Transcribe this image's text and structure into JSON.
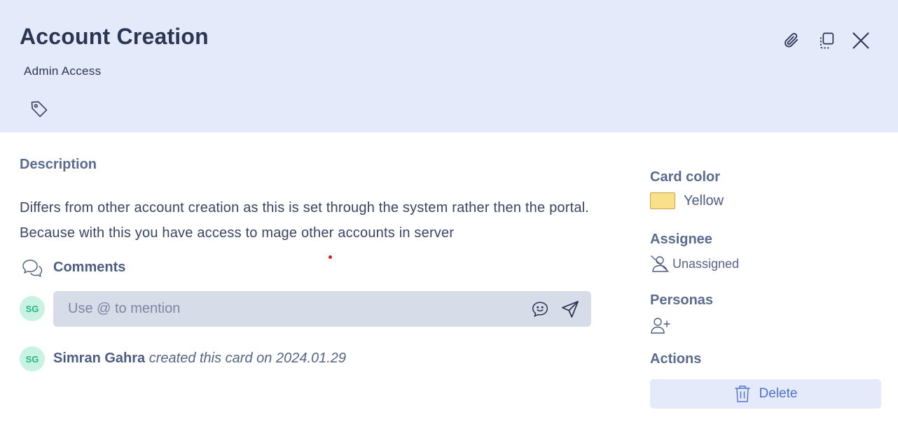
{
  "card": {
    "title": "Account Creation",
    "subtitle": "Admin Access"
  },
  "header_icons": {
    "tag": "tag-icon",
    "attach": "paperclip-icon",
    "copy": "copy-icon",
    "close": "close-icon"
  },
  "description": {
    "label": "Description",
    "text": "Differs from other account creation as this is set through the system rather then the portal. Because with this you have access to mage other accounts in server"
  },
  "comments": {
    "label": "Comments",
    "avatar_initials": "SG",
    "placeholder": "Use @ to mention"
  },
  "activity": {
    "avatar_initials": "SG",
    "user": "Simran Gahra",
    "action": "created this card on 2024.01.29"
  },
  "sidebar": {
    "card_color": {
      "label": "Card color",
      "value": "Yellow",
      "swatch": "#fbe08a"
    },
    "assignee": {
      "label": "Assignee",
      "value": "Unassigned"
    },
    "personas": {
      "label": "Personas"
    },
    "actions": {
      "label": "Actions",
      "delete_label": "Delete"
    }
  },
  "colors": {
    "header_bg": "#e5eafb",
    "accent": "#4f6fd0",
    "avatar_bg": "#c8f3e2"
  }
}
